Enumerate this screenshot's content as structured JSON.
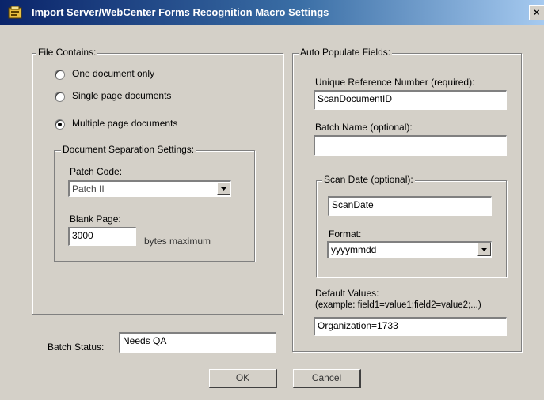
{
  "window": {
    "title": "Import Server/WebCenter Forms Recognition Macro Settings",
    "close_glyph": "×"
  },
  "file_contains": {
    "legend": "File Contains:",
    "options": [
      {
        "label": "One document only",
        "selected": false
      },
      {
        "label": "Single page documents",
        "selected": false
      },
      {
        "label": "Multiple page documents",
        "selected": true
      }
    ],
    "separation": {
      "legend": "Document Separation Settings:",
      "patch_code_label": "Patch Code:",
      "patch_code_value": "Patch II",
      "blank_page_label": "Blank Page:",
      "blank_page_value": "3000",
      "blank_page_unit": "bytes maximum"
    }
  },
  "batch_status": {
    "label": "Batch Status:",
    "value": "Needs QA"
  },
  "auto_populate": {
    "legend": "Auto Populate Fields:",
    "unique_ref_label": "Unique Reference Number (required):",
    "unique_ref_value": "ScanDocumentID",
    "batch_name_label": "Batch Name (optional):",
    "batch_name_value": "",
    "scan_date": {
      "legend": "Scan Date  (optional):",
      "value": "ScanDate",
      "format_label": "Format:",
      "format_value": "yyyymmdd"
    },
    "default_values_label": "Default Values:",
    "default_values_example": "(example: field1=value1;field2=value2;...)",
    "default_values_value": "Organization=1733"
  },
  "buttons": {
    "ok": "OK",
    "cancel": "Cancel"
  }
}
